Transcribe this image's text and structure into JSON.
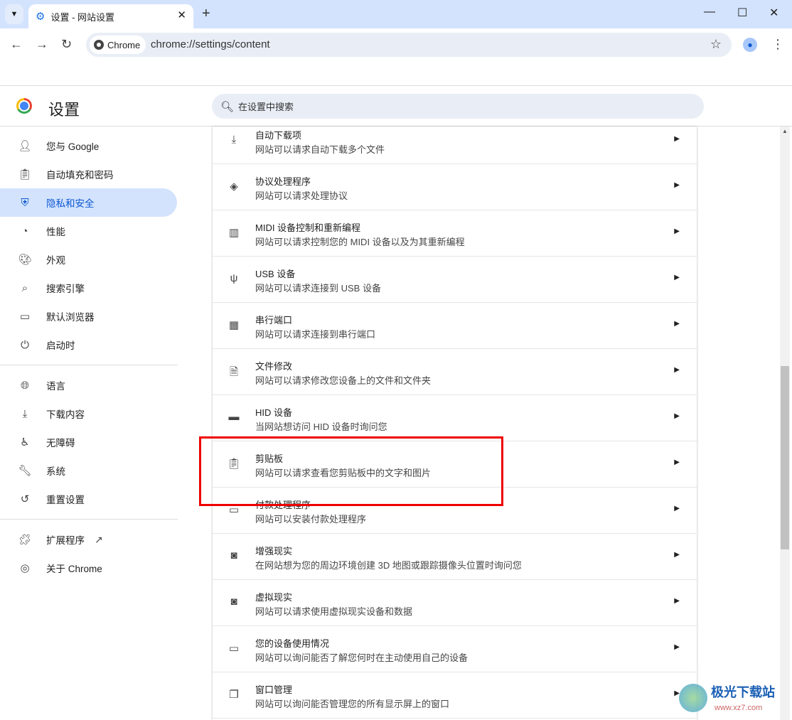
{
  "browser": {
    "tab_title": "设置 - 网站设置",
    "chip_label": "Chrome",
    "url": "chrome://settings/content"
  },
  "header": {
    "title": "设置",
    "search_placeholder": "在设置中搜索"
  },
  "sidebar": {
    "items": [
      {
        "label": "您与 Google",
        "icon": "person-icon"
      },
      {
        "label": "自动填充和密码",
        "icon": "clipboard-icon"
      },
      {
        "label": "隐私和安全",
        "icon": "shield-icon",
        "active": true
      },
      {
        "label": "性能",
        "icon": "speedometer-icon"
      },
      {
        "label": "外观",
        "icon": "palette-icon"
      },
      {
        "label": "搜索引擎",
        "icon": "search-icon"
      },
      {
        "label": "默认浏览器",
        "icon": "browser-icon"
      },
      {
        "label": "启动时",
        "icon": "power-icon"
      },
      {
        "label": "语言",
        "icon": "globe-icon"
      },
      {
        "label": "下载内容",
        "icon": "download-icon"
      },
      {
        "label": "无障碍",
        "icon": "accessibility-icon"
      },
      {
        "label": "系统",
        "icon": "wrench-icon"
      },
      {
        "label": "重置设置",
        "icon": "history-icon"
      },
      {
        "label": "扩展程序",
        "icon": "puzzle-icon"
      },
      {
        "label": "关于 Chrome",
        "icon": "chrome-icon"
      }
    ]
  },
  "main": {
    "rows": [
      {
        "title": "自动下载项",
        "subtitle": "网站可以请求自动下载多个文件",
        "icon": "download-icon"
      },
      {
        "title": "协议处理程序",
        "subtitle": "网站可以请求处理协议",
        "icon": "protocol-icon"
      },
      {
        "title": "MIDI 设备控制和重新编程",
        "subtitle": "网站可以请求控制您的 MIDI 设备以及为其重新编程",
        "icon": "piano-icon"
      },
      {
        "title": "USB 设备",
        "subtitle": "网站可以请求连接到 USB 设备",
        "icon": "usb-icon"
      },
      {
        "title": "串行端口",
        "subtitle": "网站可以请求连接到串行端口",
        "icon": "serial-port-icon"
      },
      {
        "title": "文件修改",
        "subtitle": "网站可以请求修改您设备上的文件和文件夹",
        "icon": "file-edit-icon"
      },
      {
        "title": "HID 设备",
        "subtitle": "当网站想访问 HID 设备时询问您",
        "icon": "gamepad-icon"
      },
      {
        "title": "剪贴板",
        "subtitle": "网站可以请求查看您剪贴板中的文字和图片",
        "icon": "clipboard-icon"
      },
      {
        "title": "付款处理程序",
        "subtitle": "网站可以安装付款处理程序",
        "icon": "credit-card-icon"
      },
      {
        "title": "增强现实",
        "subtitle": "在网站想为您的周边环境创建 3D 地图或跟踪摄像头位置时询问您",
        "icon": "ar-icon"
      },
      {
        "title": "虚拟现实",
        "subtitle": "网站可以请求使用虚拟现实设备和数据",
        "icon": "vr-icon"
      },
      {
        "title": "您的设备使用情况",
        "subtitle": "网站可以询问能否了解您何时在主动使用自己的设备",
        "icon": "devices-icon"
      },
      {
        "title": "窗口管理",
        "subtitle": "网站可以询问能否管理您的所有显示屏上的窗口",
        "icon": "window-icon"
      }
    ]
  },
  "highlight_color": "#ee0000",
  "watermark": {
    "name": "极光下载站",
    "url": "www.xz7.com"
  }
}
